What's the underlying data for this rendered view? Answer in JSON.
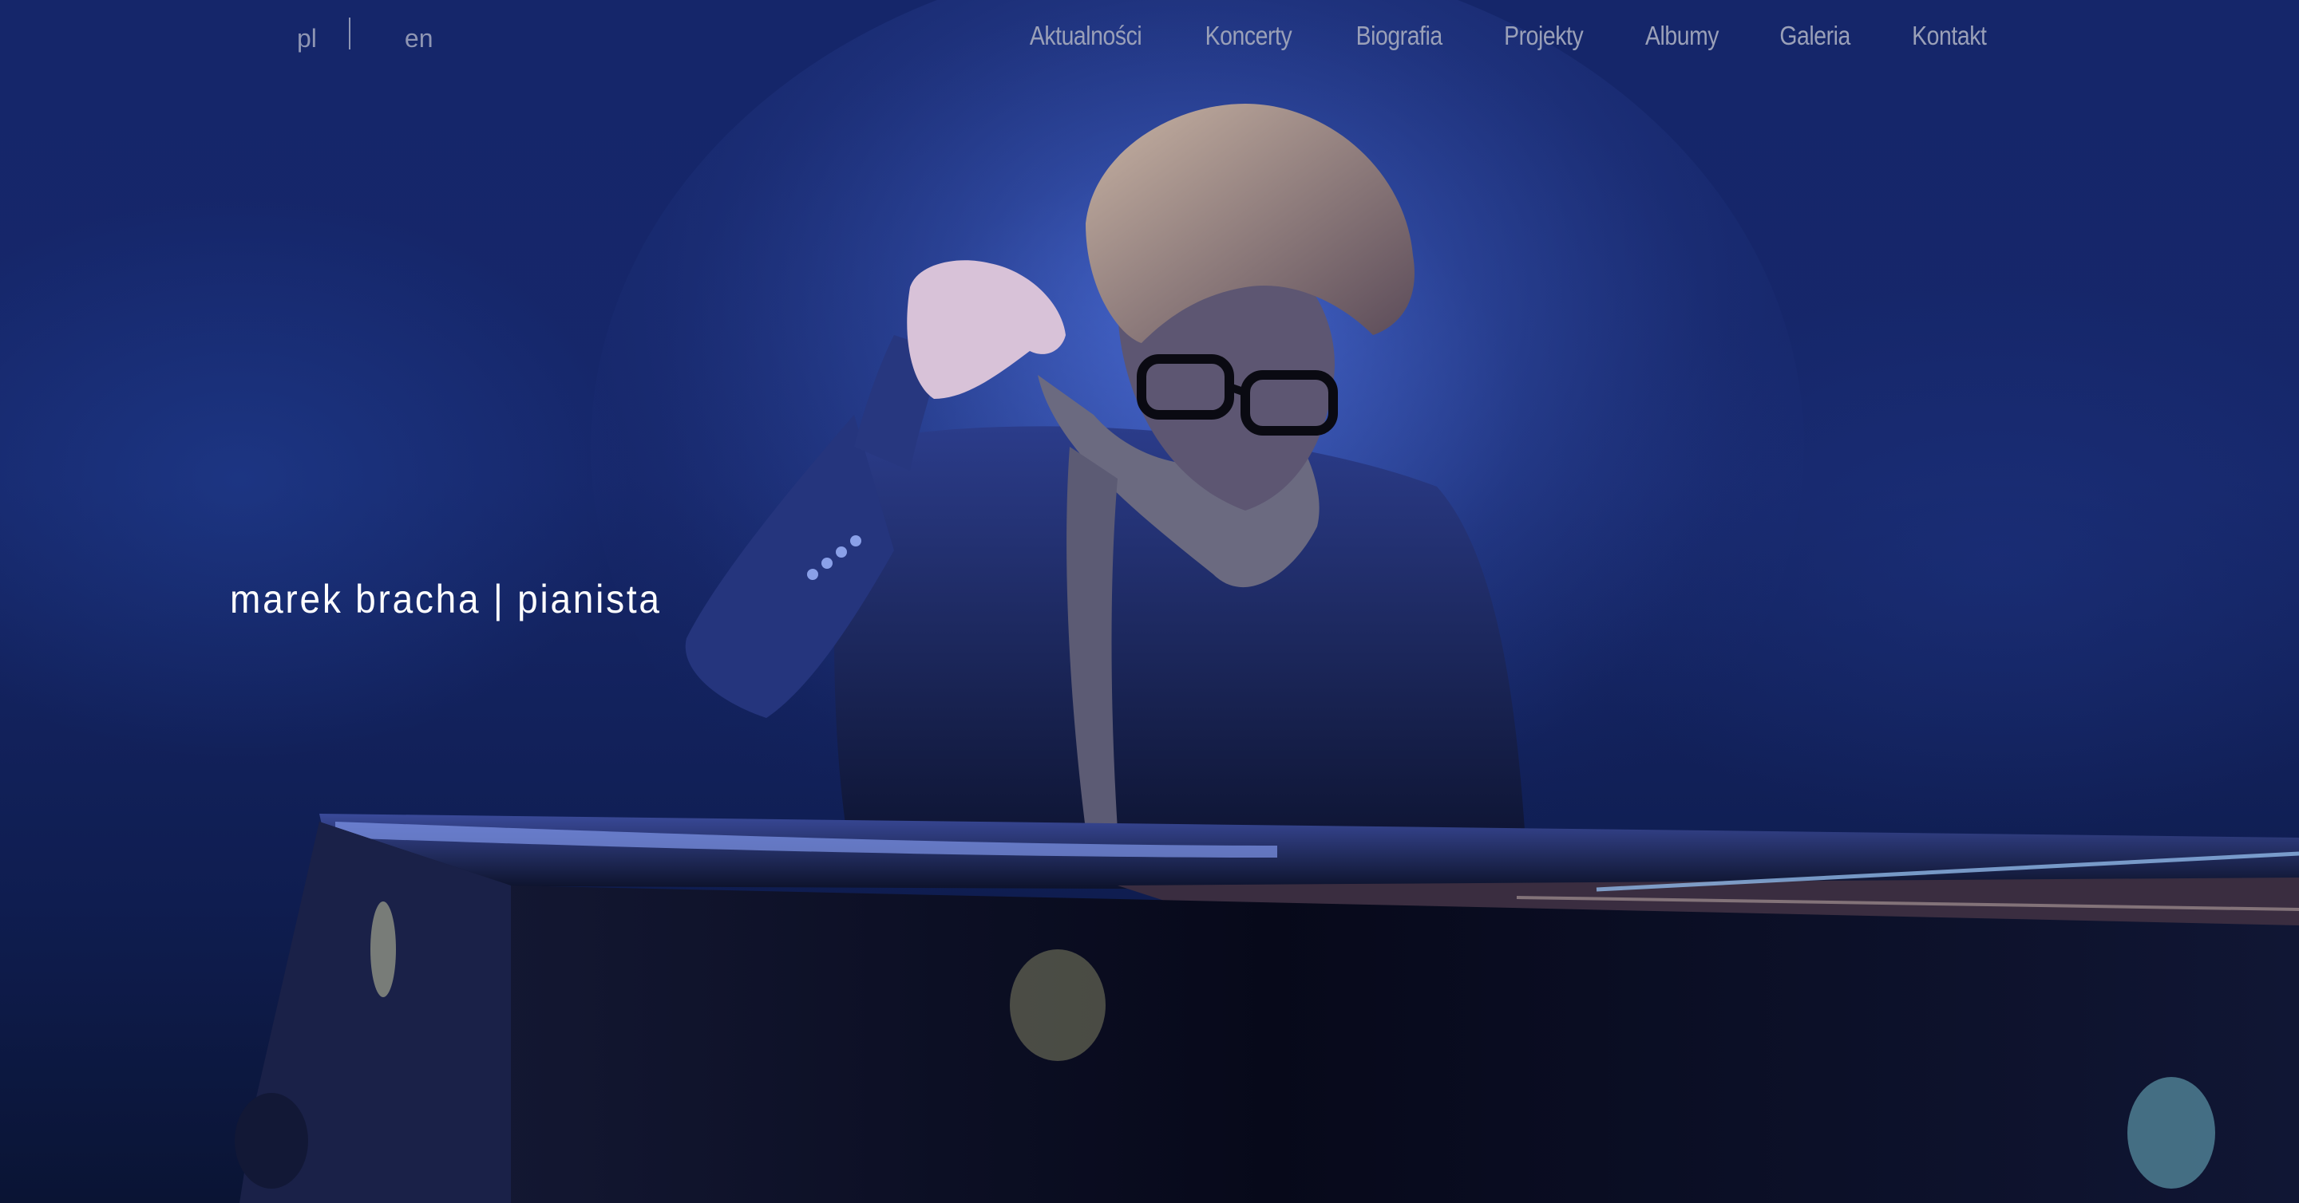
{
  "language_switcher": {
    "options": [
      "pl",
      "en"
    ]
  },
  "nav": {
    "items": [
      "Aktualności",
      "Koncerty",
      "Biografia",
      "Projekty",
      "Albumy",
      "Galeria",
      "Kontakt"
    ]
  },
  "hero": {
    "title": "marek bracha | pianista"
  },
  "colors": {
    "background": "#16276a",
    "nav_text": "#9aa0b8",
    "title_text": "#ffffff"
  }
}
